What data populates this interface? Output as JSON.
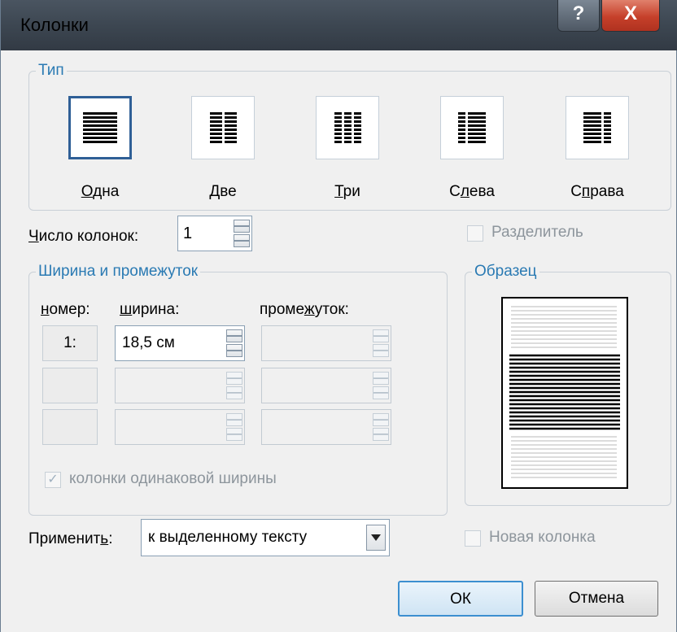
{
  "window": {
    "title": "Колонки",
    "help_glyph": "?",
    "close_glyph": "X"
  },
  "type_group": {
    "legend": "Тип",
    "presets": [
      {
        "id": "one",
        "label_pre": "",
        "label_ul": "О",
        "label_post": "дна",
        "columns": 1,
        "selected": true
      },
      {
        "id": "two",
        "label_pre": "",
        "label_ul": "Д",
        "label_post": "ве",
        "columns": 2,
        "selected": false
      },
      {
        "id": "three",
        "label_pre": "",
        "label_ul": "Т",
        "label_post": "ри",
        "columns": 3,
        "selected": false
      },
      {
        "id": "left",
        "label_pre": "С",
        "label_ul": "л",
        "label_post": "ева",
        "columns": 2,
        "selected": false
      },
      {
        "id": "right",
        "label_pre": "С",
        "label_ul": "п",
        "label_post": "рава",
        "columns": 2,
        "selected": false
      }
    ]
  },
  "count": {
    "label_ul": "Ч",
    "label_post": "исло колонок:",
    "value": "1"
  },
  "separator": {
    "label": "Разделитель",
    "checked": false,
    "enabled": false
  },
  "width_group": {
    "legend": "Ширина и промежуток",
    "col_header": {
      "ul": "н",
      "post": "омер:"
    },
    "width_header": {
      "ul": "ш",
      "post": "ирина:"
    },
    "gap_header": {
      "pre": "проме",
      "ul": "ж",
      "post": "уток:"
    },
    "rows": [
      {
        "number": "1:",
        "width": "18,5 см",
        "gap": ""
      },
      {
        "number": "",
        "width": "",
        "gap": ""
      },
      {
        "number": "",
        "width": "",
        "gap": ""
      }
    ],
    "equal_width": {
      "label": "колонки одинаковой ширины",
      "checked": true,
      "enabled": false
    }
  },
  "preview": {
    "legend": "Образец"
  },
  "apply": {
    "label_pre": "Применит",
    "label_ul": "ь",
    "label_post": ":",
    "value": "к выделенному тексту"
  },
  "new_column": {
    "label": "Новая колонка",
    "checked": false,
    "enabled": false
  },
  "buttons": {
    "ok": "ОК",
    "cancel": "Отмена"
  },
  "colors": {
    "accent": "#2a7ab3",
    "selection_border": "#2f5f96",
    "close_red": "#c6402a"
  }
}
